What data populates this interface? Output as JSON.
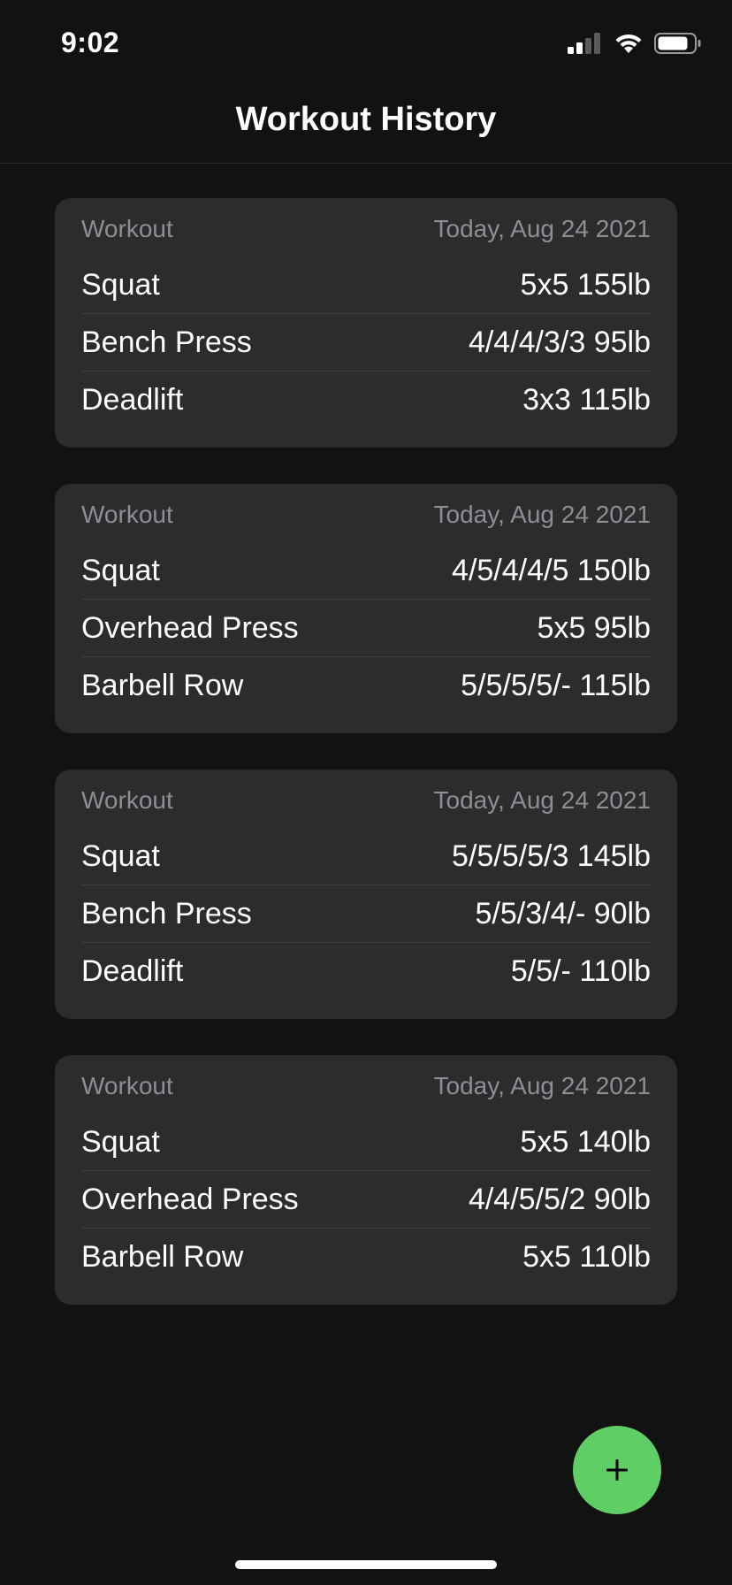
{
  "status_bar": {
    "time": "9:02"
  },
  "nav": {
    "title": "Workout History"
  },
  "workouts": [
    {
      "label": "Workout",
      "date": "Today, Aug 24 2021",
      "exercises": [
        {
          "name": "Squat",
          "result": "5x5 155lb"
        },
        {
          "name": "Bench Press",
          "result": "4/4/4/3/3 95lb"
        },
        {
          "name": "Deadlift",
          "result": "3x3 115lb"
        }
      ]
    },
    {
      "label": "Workout",
      "date": "Today, Aug 24 2021",
      "exercises": [
        {
          "name": "Squat",
          "result": "4/5/4/4/5 150lb"
        },
        {
          "name": "Overhead Press",
          "result": "5x5 95lb"
        },
        {
          "name": "Barbell Row",
          "result": "5/5/5/5/- 115lb"
        }
      ]
    },
    {
      "label": "Workout",
      "date": "Today, Aug 24 2021",
      "exercises": [
        {
          "name": "Squat",
          "result": "5/5/5/5/3 145lb"
        },
        {
          "name": "Bench Press",
          "result": "5/5/3/4/- 90lb"
        },
        {
          "name": "Deadlift",
          "result": "5/5/- 110lb"
        }
      ]
    },
    {
      "label": "Workout",
      "date": "Today, Aug 24 2021",
      "exercises": [
        {
          "name": "Squat",
          "result": "5x5 140lb"
        },
        {
          "name": "Overhead Press",
          "result": "4/4/5/5/2 90lb"
        },
        {
          "name": "Barbell Row",
          "result": "5x5 110lb"
        }
      ]
    }
  ],
  "fab": {
    "icon": "plus-icon",
    "color": "#5fcf65"
  },
  "colors": {
    "background": "#121212",
    "card": "#2c2c2e",
    "secondary_text": "#8e8e93"
  }
}
